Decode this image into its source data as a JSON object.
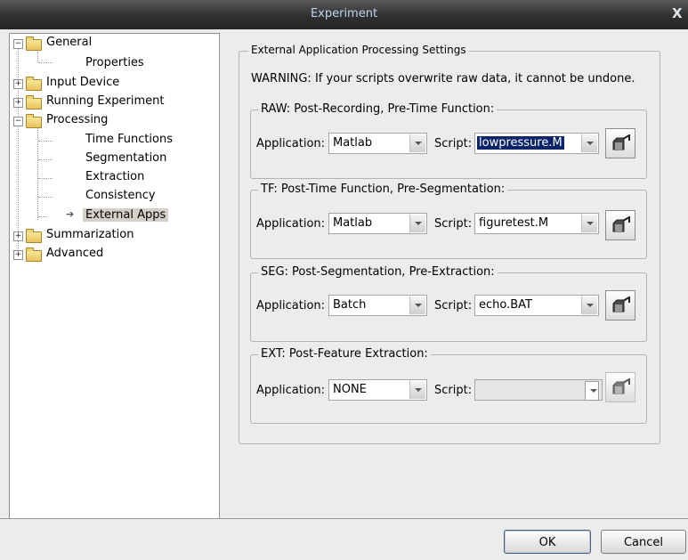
{
  "window": {
    "title": "Experiment",
    "close_glyph": "X"
  },
  "tree": {
    "general": "General",
    "properties": "Properties",
    "input_device": "Input Device",
    "running_experiment": "Running Experiment",
    "processing": "Processing",
    "time_functions": "Time Functions",
    "segmentation": "Segmentation",
    "extraction": "Extraction",
    "consistency": "Consistency",
    "external_apps": "External Apps",
    "summarization": "Summarization",
    "advanced": "Advanced",
    "selected_item": "External Apps",
    "collapsed_glyph": "+",
    "expanded_glyph": "−"
  },
  "panel": {
    "group_title": "External Application Processing Settings",
    "warning": "WARNING: If your scripts overwrite raw data, it cannot be undone."
  },
  "sections": {
    "raw": {
      "title": "RAW: Post-Recording, Pre-Time Function:",
      "application_label": "Application:",
      "application": "Matlab",
      "script_label": "Script:",
      "script": "lowpressure.M"
    },
    "tf": {
      "title": "TF: Post-Time Function, Pre-Segmentation:",
      "application_label": "Application:",
      "application": "Matlab",
      "script_label": "Script:",
      "script": "figuretest.M"
    },
    "seg": {
      "title": "SEG: Post-Segmentation, Pre-Extraction:",
      "application_label": "Application:",
      "application": "Batch",
      "script_label": "Script:",
      "script": "echo.BAT"
    },
    "ext": {
      "title": "EXT: Post-Feature Extraction:",
      "application_label": "Application:",
      "application": "NONE",
      "script_label": "Script:",
      "script": ""
    }
  },
  "footer": {
    "ok_label": "OK",
    "cancel_label": "Cancel"
  },
  "colors": {
    "selection": "#0a246a",
    "titlebar": "#3a3a3a",
    "title_text": "#bcd6f2"
  }
}
